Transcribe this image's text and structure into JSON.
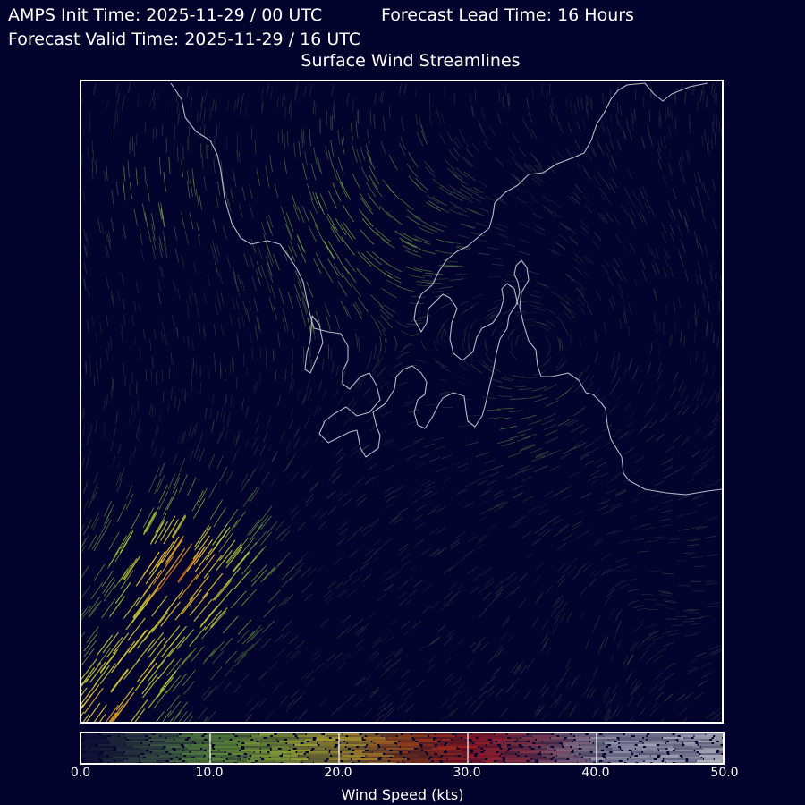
{
  "header": {
    "init_time": "AMPS Init Time: 2025-11-29 / 00 UTC",
    "lead_time": "Forecast Lead Time: 16 Hours",
    "valid_time": "Forecast Valid Time: 2025-11-29 / 16 UTC",
    "title": "Surface Wind Streamlines"
  },
  "map": {
    "background_color": "#03032e",
    "coastline_color": "#b8b8c4",
    "frame_color": "#ffffff"
  },
  "colorbar": {
    "label": "Wind Speed (kts)",
    "ticks": [
      "0.0",
      "10.0",
      "20.0",
      "30.0",
      "40.0",
      "50.0"
    ],
    "min": 0,
    "max": 50,
    "stops": [
      {
        "value": 0,
        "color": "#1a1a3a"
      },
      {
        "value": 5,
        "color": "#4a6a4a"
      },
      {
        "value": 10,
        "color": "#7fbf3f"
      },
      {
        "value": 15,
        "color": "#b6d43a"
      },
      {
        "value": 20,
        "color": "#e0c030"
      },
      {
        "value": 25,
        "color": "#c04a10"
      },
      {
        "value": 30,
        "color": "#d02020"
      },
      {
        "value": 35,
        "color": "#a05060"
      },
      {
        "value": 40,
        "color": "#c8c8d8"
      },
      {
        "value": 50,
        "color": "#f2f2f6"
      }
    ]
  }
}
